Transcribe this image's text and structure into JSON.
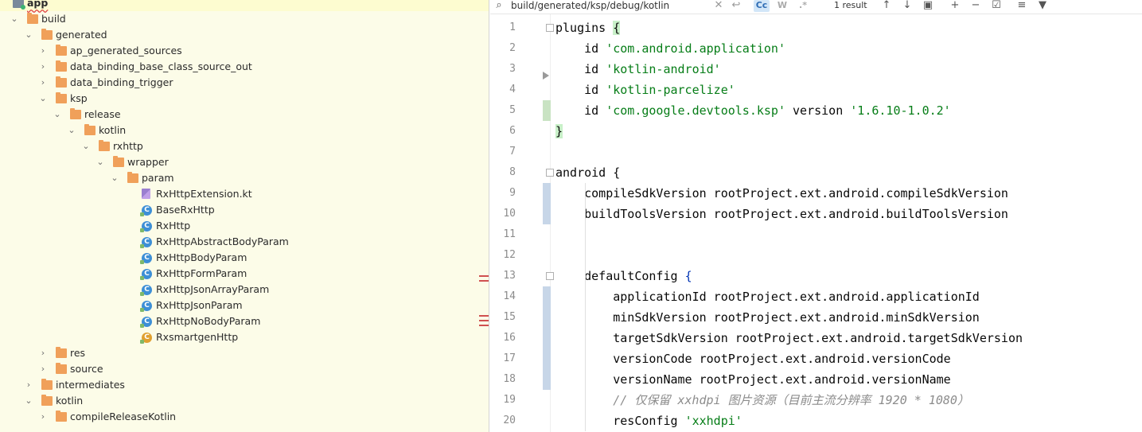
{
  "tree": {
    "rows": [
      {
        "label": "app",
        "depth": 0,
        "type": "module",
        "expanded": true,
        "bold": true
      },
      {
        "label": "build",
        "depth": 1,
        "type": "folder",
        "expanded": true
      },
      {
        "label": "generated",
        "depth": 2,
        "type": "folder",
        "expanded": true
      },
      {
        "label": "ap_generated_sources",
        "depth": 3,
        "type": "folder",
        "expanded": false
      },
      {
        "label": "data_binding_base_class_source_out",
        "depth": 3,
        "type": "folder",
        "expanded": false
      },
      {
        "label": "data_binding_trigger",
        "depth": 3,
        "type": "folder",
        "expanded": false
      },
      {
        "label": "ksp",
        "depth": 3,
        "type": "folder",
        "expanded": true
      },
      {
        "label": "release",
        "depth": 4,
        "type": "folder",
        "expanded": true
      },
      {
        "label": "kotlin",
        "depth": 5,
        "type": "folder",
        "expanded": true
      },
      {
        "label": "rxhttp",
        "depth": 6,
        "type": "folder",
        "expanded": true
      },
      {
        "label": "wrapper",
        "depth": 7,
        "type": "folder",
        "expanded": true
      },
      {
        "label": "param",
        "depth": 8,
        "type": "folder",
        "expanded": true
      },
      {
        "label": "RxHttpExtension.kt",
        "depth": 9,
        "type": "kt-file"
      },
      {
        "label": "BaseRxHttp",
        "depth": 9,
        "type": "class"
      },
      {
        "label": "RxHttp",
        "depth": 9,
        "type": "class"
      },
      {
        "label": "RxHttpAbstractBodyParam",
        "depth": 9,
        "type": "class"
      },
      {
        "label": "RxHttpBodyParam",
        "depth": 9,
        "type": "class"
      },
      {
        "label": "RxHttpFormParam",
        "depth": 9,
        "type": "class"
      },
      {
        "label": "RxHttpJsonArrayParam",
        "depth": 9,
        "type": "class"
      },
      {
        "label": "RxHttpJsonParam",
        "depth": 9,
        "type": "class"
      },
      {
        "label": "RxHttpNoBodyParam",
        "depth": 9,
        "type": "class"
      },
      {
        "label": "RxsmartgenHttp",
        "depth": 9,
        "type": "abstract-class"
      },
      {
        "label": "res",
        "depth": 3,
        "type": "folder",
        "expanded": false
      },
      {
        "label": "source",
        "depth": 3,
        "type": "folder",
        "expanded": false
      },
      {
        "label": "intermediates",
        "depth": 2,
        "type": "folder",
        "expanded": false
      },
      {
        "label": "kotlin",
        "depth": 2,
        "type": "folder",
        "expanded": true
      },
      {
        "label": "compileReleaseKotlin",
        "depth": 3,
        "type": "folder",
        "expanded": false
      }
    ]
  },
  "search": {
    "query": "build/generated/ksp/debug/kotlin",
    "result_count": "1 result",
    "case_toggle": "Cc",
    "word_toggle": "W",
    "regex_toggle": ".*"
  },
  "editor": {
    "line_numbers": [
      "1",
      "2",
      "3",
      "4",
      "5",
      "6",
      "7",
      "8",
      "9",
      "10",
      "11",
      "12",
      "13",
      "14",
      "15",
      "16",
      "17",
      "18",
      "19",
      "20"
    ],
    "lines": [
      [
        {
          "t": "plugins ",
          "c": ""
        },
        {
          "t": "{",
          "c": "brace"
        }
      ],
      [
        {
          "t": "    id ",
          "c": ""
        },
        {
          "t": "'com.android.application'",
          "c": "str"
        }
      ],
      [
        {
          "t": "    id ",
          "c": ""
        },
        {
          "t": "'kotlin-android'",
          "c": "str"
        }
      ],
      [
        {
          "t": "    id ",
          "c": ""
        },
        {
          "t": "'kotlin-parcelize'",
          "c": "str"
        }
      ],
      [
        {
          "t": "    id ",
          "c": ""
        },
        {
          "t": "'com.google.devtools.ksp'",
          "c": "str"
        },
        {
          "t": " version ",
          "c": ""
        },
        {
          "t": "'1.6.10-1.0.2'",
          "c": "str"
        }
      ],
      [
        {
          "t": "}",
          "c": "brace"
        }
      ],
      [
        {
          "t": "",
          "c": ""
        }
      ],
      [
        {
          "t": "android ",
          "c": ""
        },
        {
          "t": "{",
          "c": ""
        }
      ],
      [
        {
          "t": "    compileSdkVersion rootProject.ext.android.compileSdkVersion",
          "c": ""
        }
      ],
      [
        {
          "t": "    buildToolsVersion rootProject.ext.android.buildToolsVersion",
          "c": ""
        }
      ],
      [
        {
          "t": "",
          "c": ""
        }
      ],
      [
        {
          "t": "",
          "c": ""
        }
      ],
      [
        {
          "t": "    defaultConfig ",
          "c": ""
        },
        {
          "t": "{",
          "c": "kw"
        }
      ],
      [
        {
          "t": "        applicationId rootProject.ext.android.applicationId",
          "c": ""
        }
      ],
      [
        {
          "t": "        minSdkVersion rootProject.ext.android.minSdkVersion",
          "c": ""
        }
      ],
      [
        {
          "t": "        targetSdkVersion rootProject.ext.android.targetSdkVersion",
          "c": ""
        }
      ],
      [
        {
          "t": "        versionCode rootProject.ext.android.versionCode",
          "c": ""
        }
      ],
      [
        {
          "t": "        versionName rootProject.ext.android.versionName",
          "c": ""
        }
      ],
      [
        {
          "t": "        // 仅保留 xxhdpi 图片资源（目前主流分辨率 1920 * 1080）",
          "c": "cm"
        }
      ],
      [
        {
          "t": "        resConfig ",
          "c": ""
        },
        {
          "t": "'xxhdpi'",
          "c": "str"
        }
      ]
    ]
  },
  "colors": {
    "tree_background": "#fcfce8",
    "folder": "#f0a05a",
    "string": "#067d17",
    "changed_line_marker": "#c7d6e8",
    "added_line_marker": "#c9e3c3"
  }
}
